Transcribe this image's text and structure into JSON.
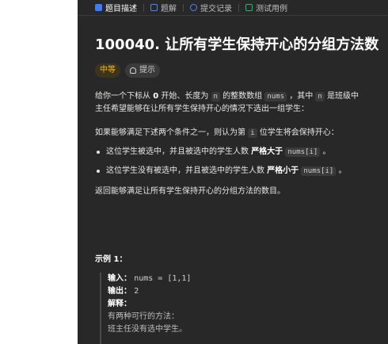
{
  "tabs": [
    {
      "label": "题目描述"
    },
    {
      "label": "题解"
    },
    {
      "label": "提交记录"
    },
    {
      "label": "测试用例"
    }
  ],
  "problem": {
    "title": "100040. 让所有学生保持开心的分组方法数",
    "difficulty": "中等",
    "hint_label": "提示"
  },
  "content": {
    "p1_a": "给你一个下标从",
    "p1_b": "0",
    "p1_c": "开始、长度为",
    "p1_n": "n",
    "p1_d": "的整数数组",
    "p1_nums": "nums",
    "p1_e": "，其中",
    "p1_n2": "n",
    "p1_f": "是班级中",
    "p2": "主任希望能够在让所有学生保持开心的情况下选出一组学生：",
    "p3_a": "如果能够满足下述两个条件之一，则认为第",
    "p3_i": "i",
    "p3_b": "位学生将会保持开心：",
    "b1_a": "这位学生被选中，并且被选中的学生人数",
    "b1_strong": "严格大于",
    "b1_code": "nums[i]",
    "b1_end": "。",
    "b2_a": "这位学生没有被选中，并且被选中的学生人数",
    "b2_strong": "严格小于",
    "b2_code": "nums[i]",
    "b2_end": "。",
    "p4": "返回能够满足让所有学生保持开心的分组方法的数目。"
  },
  "example": {
    "title": "示例 1：",
    "input_label": "输入：",
    "input_value": "nums = [1,1]",
    "output_label": "输出：",
    "output_value": "2",
    "explain_label": "解释：",
    "line1": "有两种可行的方法：",
    "line2": "班主任没有选中学生。"
  },
  "colors": {
    "panel_bg": "#282828",
    "accent_blue": "#3a7cff",
    "difficulty_yellow": "#ffb800"
  }
}
